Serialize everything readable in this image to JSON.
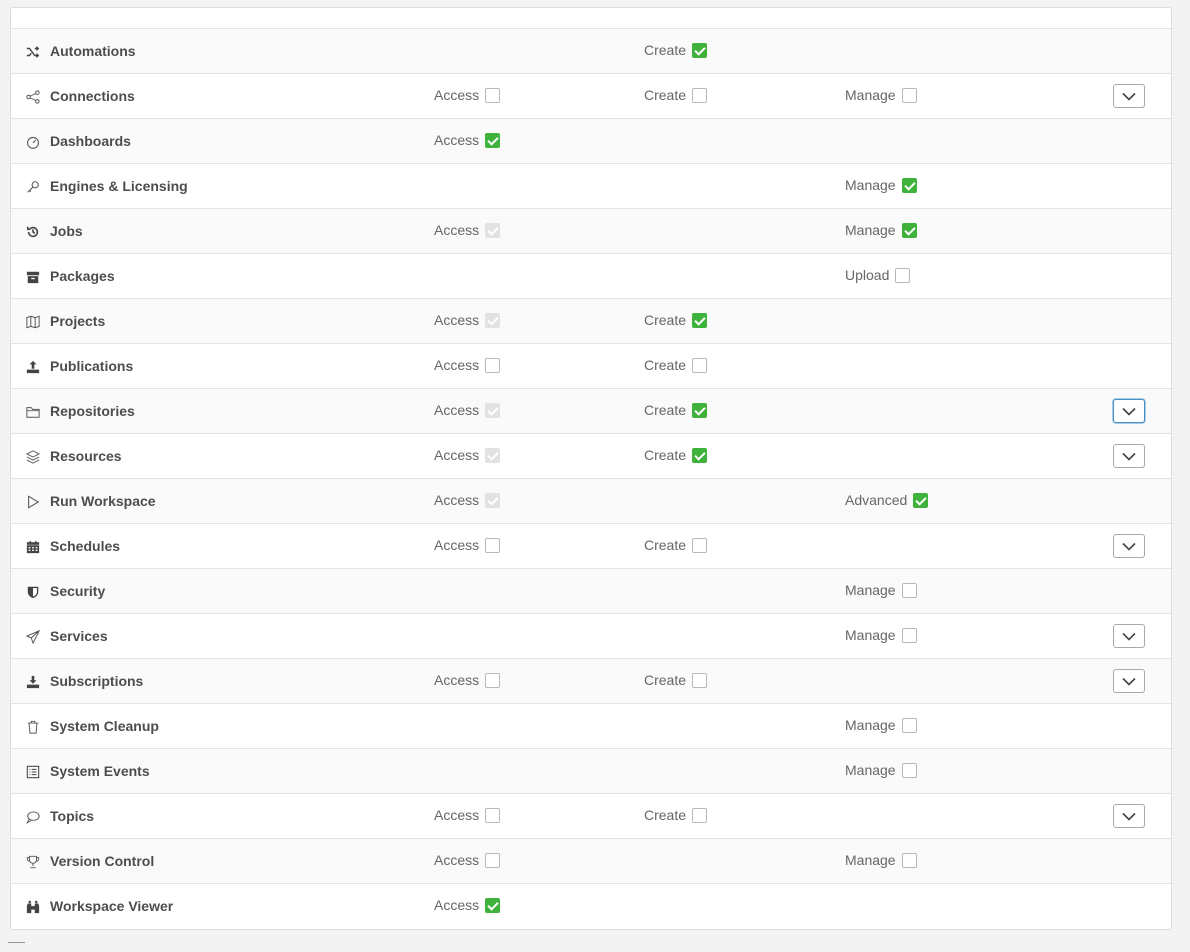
{
  "permissions": {
    "rows": [
      {
        "name": "Automations",
        "icon": "shuffle-icon",
        "access": null,
        "create": {
          "label": "Create",
          "state": "checked"
        },
        "manage": null,
        "expand": false
      },
      {
        "name": "Connections",
        "icon": "share-icon",
        "access": {
          "label": "Access",
          "state": "unchecked"
        },
        "create": {
          "label": "Create",
          "state": "unchecked"
        },
        "manage": {
          "label": "Manage",
          "state": "unchecked"
        },
        "expand": true
      },
      {
        "name": "Dashboards",
        "icon": "gauge-icon",
        "access": {
          "label": "Access",
          "state": "checked"
        },
        "create": null,
        "manage": null,
        "expand": false
      },
      {
        "name": "Engines & Licensing",
        "icon": "key-icon",
        "access": null,
        "create": null,
        "manage": {
          "label": "Manage",
          "state": "checked"
        },
        "expand": false
      },
      {
        "name": "Jobs",
        "icon": "history-icon",
        "access": {
          "label": "Access",
          "state": "disabled-checked"
        },
        "create": null,
        "manage": {
          "label": "Manage",
          "state": "checked"
        },
        "expand": false
      },
      {
        "name": "Packages",
        "icon": "archive-box-icon",
        "access": null,
        "create": null,
        "manage": {
          "label": "Upload",
          "state": "unchecked"
        },
        "expand": false
      },
      {
        "name": "Projects",
        "icon": "map-icon",
        "access": {
          "label": "Access",
          "state": "disabled-checked"
        },
        "create": {
          "label": "Create",
          "state": "checked"
        },
        "manage": null,
        "expand": false
      },
      {
        "name": "Publications",
        "icon": "upload-icon",
        "access": {
          "label": "Access",
          "state": "unchecked"
        },
        "create": {
          "label": "Create",
          "state": "unchecked"
        },
        "manage": null,
        "expand": false
      },
      {
        "name": "Repositories",
        "icon": "folder-icon",
        "access": {
          "label": "Access",
          "state": "disabled-checked"
        },
        "create": {
          "label": "Create",
          "state": "checked"
        },
        "manage": null,
        "expand": true,
        "focused": true
      },
      {
        "name": "Resources",
        "icon": "layers-icon",
        "access": {
          "label": "Access",
          "state": "disabled-checked"
        },
        "create": {
          "label": "Create",
          "state": "checked"
        },
        "manage": null,
        "expand": true
      },
      {
        "name": "Run Workspace",
        "icon": "play-icon",
        "access": {
          "label": "Access",
          "state": "disabled-checked"
        },
        "create": null,
        "manage": {
          "label": "Advanced",
          "state": "checked"
        },
        "expand": false
      },
      {
        "name": "Schedules",
        "icon": "calendar-icon",
        "access": {
          "label": "Access",
          "state": "unchecked"
        },
        "create": {
          "label": "Create",
          "state": "unchecked"
        },
        "manage": null,
        "expand": true
      },
      {
        "name": "Security",
        "icon": "shield-icon",
        "access": null,
        "create": null,
        "manage": {
          "label": "Manage",
          "state": "unchecked"
        },
        "expand": false
      },
      {
        "name": "Services",
        "icon": "paper-plane-icon",
        "access": null,
        "create": null,
        "manage": {
          "label": "Manage",
          "state": "unchecked"
        },
        "expand": true
      },
      {
        "name": "Subscriptions",
        "icon": "download-icon",
        "access": {
          "label": "Access",
          "state": "unchecked"
        },
        "create": {
          "label": "Create",
          "state": "unchecked"
        },
        "manage": null,
        "expand": true
      },
      {
        "name": "System Cleanup",
        "icon": "trash-icon",
        "access": null,
        "create": null,
        "manage": {
          "label": "Manage",
          "state": "unchecked"
        },
        "expand": false
      },
      {
        "name": "System Events",
        "icon": "list-icon",
        "access": null,
        "create": null,
        "manage": {
          "label": "Manage",
          "state": "unchecked"
        },
        "expand": false
      },
      {
        "name": "Topics",
        "icon": "speech-bubble-icon",
        "access": {
          "label": "Access",
          "state": "unchecked"
        },
        "create": {
          "label": "Create",
          "state": "unchecked"
        },
        "manage": null,
        "expand": true
      },
      {
        "name": "Version Control",
        "icon": "trophy-icon",
        "access": {
          "label": "Access",
          "state": "unchecked"
        },
        "create": null,
        "manage": {
          "label": "Manage",
          "state": "unchecked"
        },
        "expand": false
      },
      {
        "name": "Workspace Viewer",
        "icon": "binoculars-icon",
        "access": {
          "label": "Access",
          "state": "checked"
        },
        "create": null,
        "manage": null,
        "expand": false
      }
    ]
  },
  "colors": {
    "checked": "#3fb23b",
    "disabled": "#e2e2e2",
    "focus": "#4a90c2"
  }
}
